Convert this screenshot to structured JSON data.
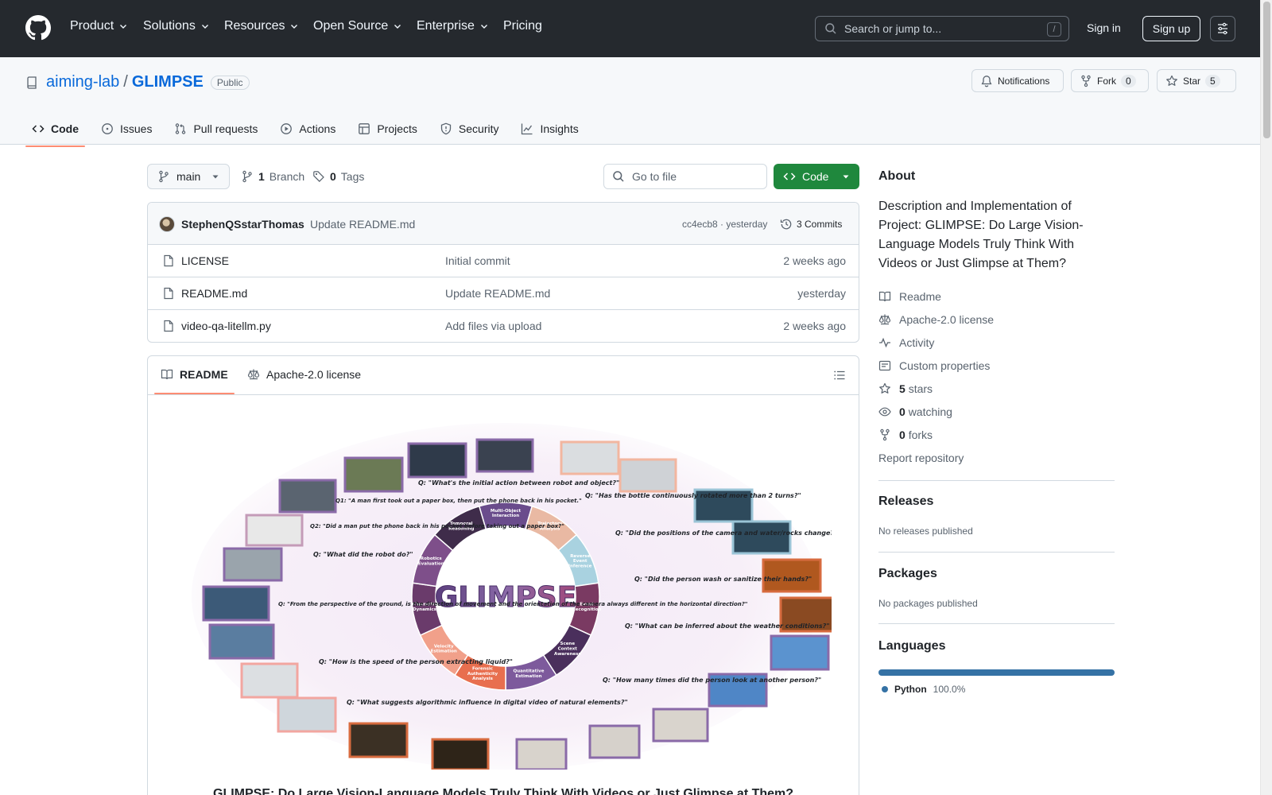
{
  "header": {
    "nav": [
      "Product",
      "Solutions",
      "Resources",
      "Open Source",
      "Enterprise",
      "Pricing"
    ],
    "search_placeholder": "Search or jump to...",
    "search_shortcut": "/",
    "signin": "Sign in",
    "signup": "Sign up"
  },
  "repo": {
    "owner": "aiming-lab",
    "separator": "/",
    "name": "GLIMPSE",
    "visibility": "Public",
    "notifications_label": "Notifications",
    "fork_label": "Fork",
    "fork_count": "0",
    "star_label": "Star",
    "star_count": "5",
    "tabs": [
      "Code",
      "Issues",
      "Pull requests",
      "Actions",
      "Projects",
      "Security",
      "Insights"
    ]
  },
  "files_bar": {
    "branch": "main",
    "branch_count": "1",
    "branch_label": "Branch",
    "tag_count": "0",
    "tag_label": "Tags",
    "goto_placeholder": "Go to file",
    "code_button": "Code"
  },
  "latest_commit": {
    "author": "StephenQSstarThomas",
    "message": "Update README.md",
    "sha_time": "cc4ecb8 · yesterday",
    "commits": "3 Commits"
  },
  "files": [
    {
      "name": "LICENSE",
      "message": "Initial commit",
      "date": "2 weeks ago"
    },
    {
      "name": "README.md",
      "message": "Update README.md",
      "date": "yesterday"
    },
    {
      "name": "video-qa-litellm.py",
      "message": "Add files via upload",
      "date": "2 weeks ago"
    }
  ],
  "readme": {
    "tab_readme": "README",
    "tab_license": "Apache-2.0 license",
    "figure_title": "GLIMPSE",
    "heading": "GLIMPSE: Do Large Vision-Language Models Truly Think With Videos or Just Glimpse at Them?",
    "categories": [
      "Multi-Object Interaction",
      "Trajectory Analysis",
      "Reverse Event Inference",
      "Event Recognition",
      "Scene Context Awareness",
      "Quantitative Estimation",
      "Forensic Authenticity Analysis",
      "Velocity Estimation",
      "Cinematic Dynamics",
      "Robotics Evaluation",
      "Temporal Reasoning"
    ],
    "questions": [
      "Q: \"What's the initial action between robot and object?\"",
      "Q: \"Has the bottle continuously rotated more than 2 turns?\"",
      "Q: \"Did the positions of the camera and water/rocks change?\"",
      "Q: \"Did the person wash or sanitize their hands?\"",
      "Q: \"What can be inferred about the weather conditions?\"",
      "Q: \"How many times did the person look at another person?\"",
      "Q: \"What suggests algorithmic influence in digital video of natural elements?\"",
      "Q: \"How is the speed of the person extracting liquid?\"",
      "Q: \"From the perspective of the ground, is the direction of movement and the orientation of the camera always different in the horizontal direction?\"",
      "Q: \"What did the robot do?\"",
      "Q2: \"Did a man put the phone back in his pocket before taking out a paper box?\"",
      "Q1: \"A man first took out a paper box, then put the phone back in his pocket.\""
    ]
  },
  "about": {
    "heading": "About",
    "description": "Description and Implementation of Project: GLIMPSE: Do Large Vision-Language Models Truly Think With Videos or Just Glimpse at Them?",
    "readme": "Readme",
    "license": "Apache-2.0 license",
    "activity": "Activity",
    "custom_properties": "Custom properties",
    "stars_count": "5",
    "stars_label": "stars",
    "watching_count": "0",
    "watching_label": "watching",
    "forks_count": "0",
    "forks_label": "forks",
    "report": "Report repository"
  },
  "releases": {
    "heading": "Releases",
    "empty": "No releases published"
  },
  "packages": {
    "heading": "Packages",
    "empty": "No packages published"
  },
  "languages": {
    "heading": "Languages",
    "items": [
      {
        "name": "Python",
        "percent": "100.0%",
        "color": "#3572a5"
      }
    ]
  },
  "colors": {
    "header_bg": "#25292e",
    "link": "#0969da",
    "primary_button": "#1f883d",
    "active_tab_underline": "#fd8c73"
  }
}
